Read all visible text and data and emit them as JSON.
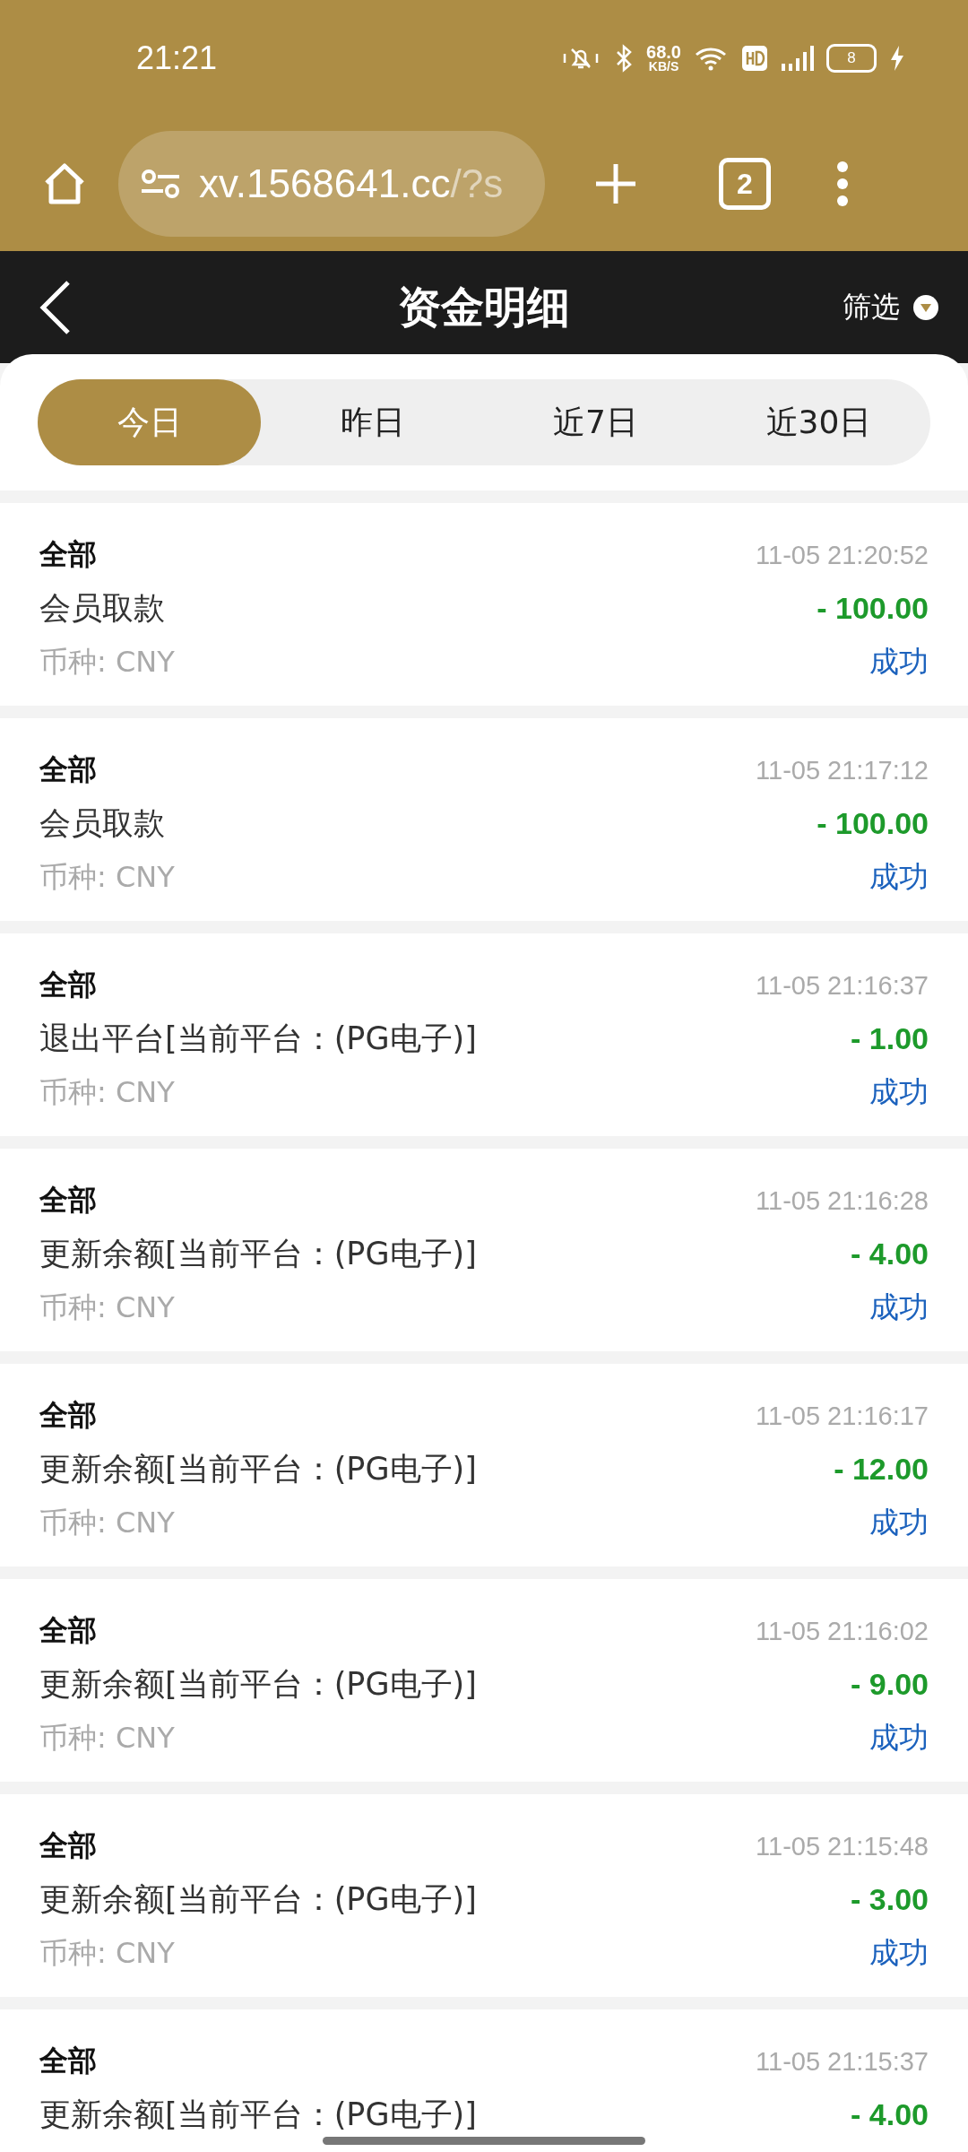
{
  "status_bar": {
    "time": "21:21",
    "net_speed": "68.0",
    "net_unit": "KB/S",
    "battery": "8",
    "charging": true
  },
  "browser": {
    "url_main": "xv.1568641.cc",
    "url_rest": "/?s",
    "tab_count": "2"
  },
  "header": {
    "title": "资金明细",
    "filter": "筛选"
  },
  "tabs": [
    {
      "label": "今日",
      "selected": true
    },
    {
      "label": "昨日",
      "selected": false
    },
    {
      "label": "近7日",
      "selected": false
    },
    {
      "label": "近30日",
      "selected": false
    }
  ],
  "records": [
    {
      "category": "全部",
      "time": "11-05 21:20:52",
      "description": "会员取款",
      "amount": "- 100.00",
      "currency": "币种: CNY",
      "status": "成功"
    },
    {
      "category": "全部",
      "time": "11-05 21:17:12",
      "description": "会员取款",
      "amount": "- 100.00",
      "currency": "币种: CNY",
      "status": "成功"
    },
    {
      "category": "全部",
      "time": "11-05 21:16:37",
      "description": "退出平台[当前平台：(PG电子)]",
      "amount": "- 1.00",
      "currency": "币种: CNY",
      "status": "成功"
    },
    {
      "category": "全部",
      "time": "11-05 21:16:28",
      "description": "更新余额[当前平台：(PG电子)]",
      "amount": "- 4.00",
      "currency": "币种: CNY",
      "status": "成功"
    },
    {
      "category": "全部",
      "time": "11-05 21:16:17",
      "description": "更新余额[当前平台：(PG电子)]",
      "amount": "- 12.00",
      "currency": "币种: CNY",
      "status": "成功"
    },
    {
      "category": "全部",
      "time": "11-05 21:16:02",
      "description": "更新余额[当前平台：(PG电子)]",
      "amount": "- 9.00",
      "currency": "币种: CNY",
      "status": "成功"
    },
    {
      "category": "全部",
      "time": "11-05 21:15:48",
      "description": "更新余额[当前平台：(PG电子)]",
      "amount": "- 3.00",
      "currency": "币种: CNY",
      "status": "成功"
    },
    {
      "category": "全部",
      "time": "11-05 21:15:37",
      "description": "更新余额[当前平台：(PG电子)]",
      "amount": "- 4.00"
    }
  ]
}
